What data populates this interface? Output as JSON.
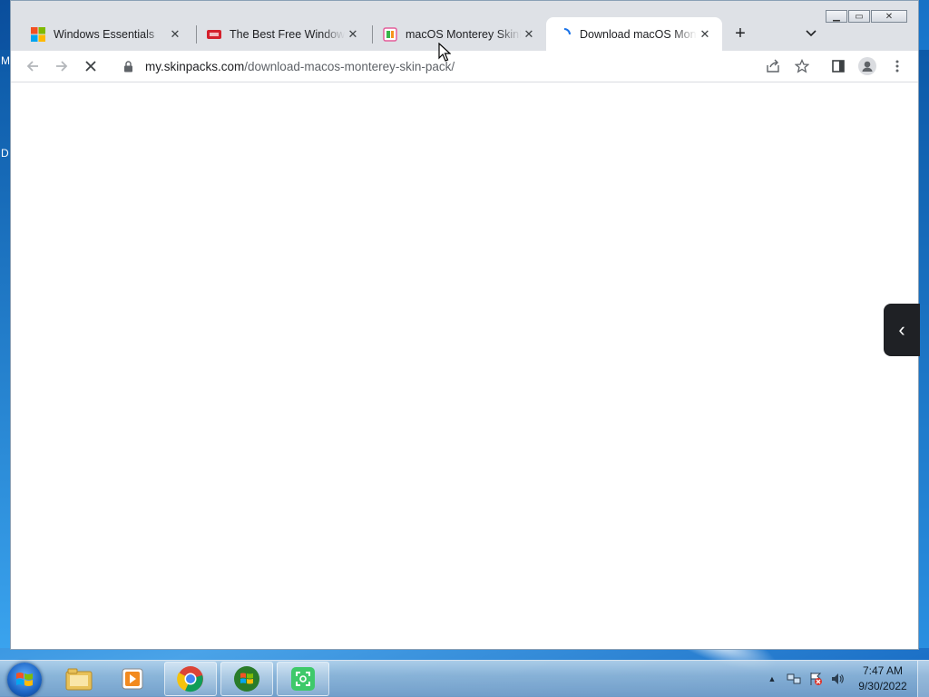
{
  "desktop": {
    "edge_letters": [
      "M",
      "D"
    ]
  },
  "browser": {
    "tabs": [
      {
        "title": "Windows Essentials",
        "icon": "microsoft-logo-icon",
        "active": false
      },
      {
        "title": "The Best Free Windows",
        "icon": "red-site-icon",
        "active": false
      },
      {
        "title": "macOS Monterey SkinPack",
        "icon": "skinpack-icon",
        "active": false
      },
      {
        "title": "Download macOS Monterey Skin Pack",
        "icon": "loading-spinner-icon",
        "active": true
      }
    ],
    "new_tab_label": "+",
    "address": {
      "domain": "my.skinpacks.com",
      "path": "/download-macos-monterey-skin-pack/"
    },
    "window_controls": {
      "minimize": "▁",
      "maximize": "▭",
      "close": "✕"
    }
  },
  "side_panel": {
    "arrow": "‹"
  },
  "taskbar": {
    "clock_time": "7:47 AM",
    "clock_date": "9/30/2022",
    "tray_chevron": "▲"
  },
  "colors": {
    "chrome_frame": "#dee1e6",
    "active_tab": "#ffffff",
    "taskbar": "#9fbddb",
    "desktop": "#1c7fd6"
  }
}
